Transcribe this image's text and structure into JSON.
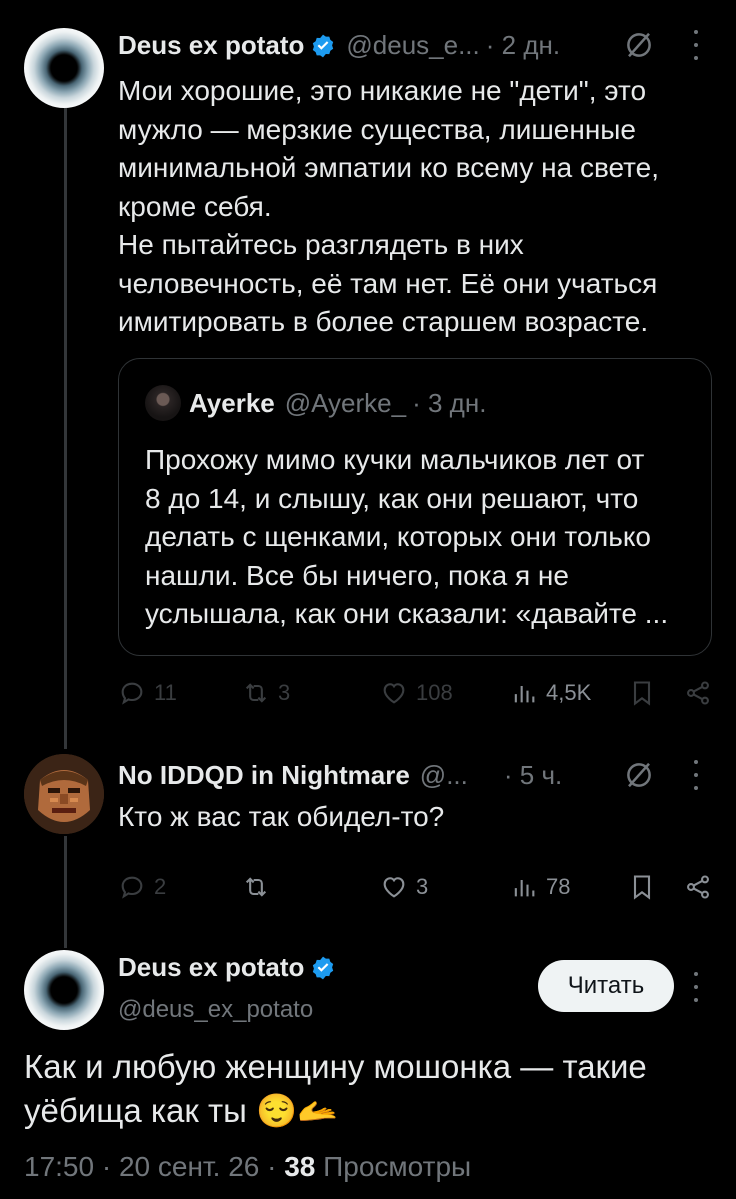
{
  "tweet1": {
    "name": "Deus ex potato",
    "handle": "@deus_e...",
    "time": "· 2 дн.",
    "text": "Мои хорошие, это никакие не \"дети\", это\nмужло — мерзкие существа, лишенные\nминимальной эмпатии ко всему на свете,\nкроме себя.\nНе пытайтесь разглядеть в них\nчеловечность, её там нет. Её они учаться\nимитировать в более старшем возрасте.",
    "quote": {
      "name": "Ayerke",
      "handle": "@Ayerke_",
      "time": "· 3 дн.",
      "text": "Прохожу мимо кучки мальчиков лет от\n8 до 14, и слышу, как они решают, что\nделать с щенками, которых они только\nнашли. Все бы ничего, пока я не\nуслышала, как они сказали: «давайте ..."
    },
    "actions": {
      "replies": "11",
      "reposts": "3",
      "likes": "108",
      "views": "4,5K"
    }
  },
  "tweet2": {
    "name": "No IDDQD in Nightmare",
    "handle": "@...",
    "time": "· 5 ч.",
    "text": "Кто ж вас так обидел-то?",
    "actions": {
      "replies": "2",
      "reposts": "",
      "likes": "3",
      "views": "78"
    }
  },
  "main": {
    "name": "Deus ex potato",
    "handle": "@deus_ex_potato",
    "follow_label": "Читать",
    "text": "Как и любую женщину мошонка — такие\nуёбища как ты",
    "emoji": "😌🫴",
    "time": "17:50 · 20 сент. 26 · ",
    "views_count": "38",
    "views_label": " Просмотры"
  },
  "colors": {
    "background": "#000000",
    "text": "#e7e9ea",
    "muted": "#71767b",
    "verified": "#1d9bf0",
    "border": "#2f3336"
  },
  "icons": [
    "verified-badge-icon",
    "grok-icon",
    "more-icon",
    "reply-icon",
    "repost-icon",
    "like-icon",
    "views-icon",
    "bookmark-icon",
    "share-icon"
  ]
}
